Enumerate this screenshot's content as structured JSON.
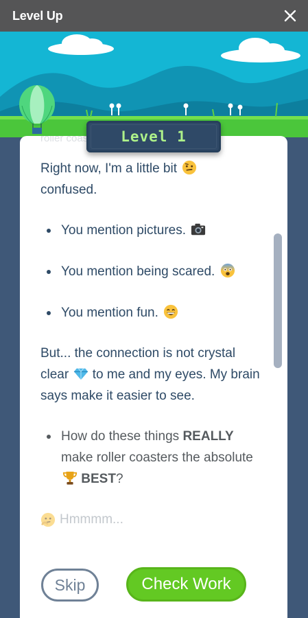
{
  "window": {
    "title": "Level Up"
  },
  "badge": {
    "label": "Level 1"
  },
  "ghost_text": "roller coasters ...",
  "content": {
    "intro_text": "Right now, I'm a little bit",
    "intro_emoji": "confused-face-icon",
    "intro_tail": "confused.",
    "observations": [
      {
        "text": "You mention pictures.",
        "icon": "camera-icon"
      },
      {
        "text": "You mention being scared.",
        "icon": "scared-face-icon"
      },
      {
        "text": "You mention fun.",
        "icon": "grinning-face-icon"
      }
    ],
    "connection_part1": "But... the connection is not crystal clear",
    "connection_icon": "diamond-icon",
    "connection_part2": "to me and my eyes. My brain says make it easier to see.",
    "question_part1": "How do these things",
    "question_strong1": "REALLY",
    "question_part2": "make roller coasters the absolute",
    "question_icon": "trophy-icon",
    "question_strong2": "BEST",
    "question_end": "?",
    "thinking_text": "Hmmmm..."
  },
  "actions": {
    "skip_label": "Skip",
    "check_label": "Check Work"
  },
  "colors": {
    "titlebar": "#555556",
    "background": "#3f5878",
    "text": "#2e4a66",
    "check_button": "#63c923",
    "skip_border": "#6f8196",
    "badge_text": "#aef28a",
    "sky": "#14b6d4"
  }
}
